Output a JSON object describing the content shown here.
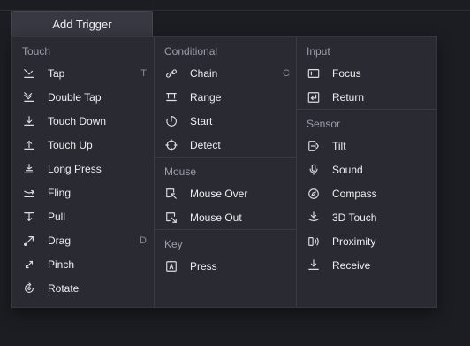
{
  "tab_label": "Add Trigger",
  "columns": [
    {
      "sections": [
        {
          "title": "Touch",
          "items": [
            {
              "label": "Tap",
              "shortcut": "T",
              "icon": "tap-icon"
            },
            {
              "label": "Double Tap",
              "shortcut": "",
              "icon": "double-tap-icon"
            },
            {
              "label": "Touch Down",
              "shortcut": "",
              "icon": "touch-down-icon"
            },
            {
              "label": "Touch Up",
              "shortcut": "",
              "icon": "touch-up-icon"
            },
            {
              "label": "Long Press",
              "shortcut": "",
              "icon": "long-press-icon"
            },
            {
              "label": "Fling",
              "shortcut": "",
              "icon": "fling-icon"
            },
            {
              "label": "Pull",
              "shortcut": "",
              "icon": "pull-icon"
            },
            {
              "label": "Drag",
              "shortcut": "D",
              "icon": "drag-icon"
            },
            {
              "label": "Pinch",
              "shortcut": "",
              "icon": "pinch-icon"
            },
            {
              "label": "Rotate",
              "shortcut": "",
              "icon": "rotate-icon"
            }
          ]
        }
      ]
    },
    {
      "sections": [
        {
          "title": "Conditional",
          "items": [
            {
              "label": "Chain",
              "shortcut": "C",
              "icon": "chain-icon"
            },
            {
              "label": "Range",
              "shortcut": "",
              "icon": "range-icon"
            },
            {
              "label": "Start",
              "shortcut": "",
              "icon": "start-icon"
            },
            {
              "label": "Detect",
              "shortcut": "",
              "icon": "detect-icon"
            }
          ]
        },
        {
          "title": "Mouse",
          "items": [
            {
              "label": "Mouse Over",
              "shortcut": "",
              "icon": "mouse-over-icon"
            },
            {
              "label": "Mouse Out",
              "shortcut": "",
              "icon": "mouse-out-icon"
            }
          ]
        },
        {
          "title": "Key",
          "items": [
            {
              "label": "Press",
              "shortcut": "",
              "icon": "key-press-icon"
            }
          ]
        }
      ]
    },
    {
      "sections": [
        {
          "title": "Input",
          "items": [
            {
              "label": "Focus",
              "shortcut": "",
              "icon": "focus-icon"
            },
            {
              "label": "Return",
              "shortcut": "",
              "icon": "return-icon"
            }
          ]
        },
        {
          "title": "Sensor",
          "items": [
            {
              "label": "Tilt",
              "shortcut": "",
              "icon": "tilt-icon"
            },
            {
              "label": "Sound",
              "shortcut": "",
              "icon": "sound-icon"
            },
            {
              "label": "Compass",
              "shortcut": "",
              "icon": "compass-icon"
            },
            {
              "label": "3D Touch",
              "shortcut": "",
              "icon": "3d-touch-icon"
            },
            {
              "label": "Proximity",
              "shortcut": "",
              "icon": "proximity-icon"
            },
            {
              "label": "Receive",
              "shortcut": "",
              "icon": "receive-icon"
            }
          ]
        }
      ]
    }
  ]
}
